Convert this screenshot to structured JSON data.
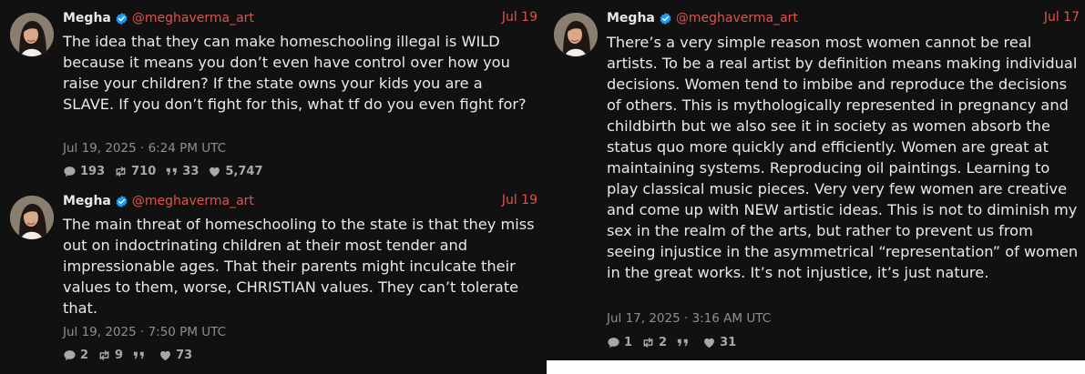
{
  "tweets": [
    {
      "name": "Megha",
      "handle": "@meghaverma_art",
      "date": "Jul 19",
      "text": "The idea that they can make homeschooling illegal is WILD because it means you don’t even have control over how you raise your children? If the state owns your kids you are a SLAVE. If you don’t fight for this, what tf do you even fight for?",
      "timestamp": "Jul 19, 2025 · 6:24 PM UTC",
      "stats": {
        "replies": "193",
        "retweets": "710",
        "quotes": "33",
        "likes": "5,747"
      }
    },
    {
      "name": "Megha",
      "handle": "@meghaverma_art",
      "date": "Jul 19",
      "text": "The main threat of homeschooling to the state is that they miss out on indoctrinating children at their most tender and impressionable ages. That their parents might inculcate their values to them, worse, CHRISTIAN values. They can’t tolerate that.",
      "timestamp": "Jul 19, 2025 · 7:50 PM UTC",
      "stats": {
        "replies": "2",
        "retweets": "9",
        "quotes": "",
        "likes": "73"
      }
    },
    {
      "name": "Megha",
      "handle": "@meghaverma_art",
      "date": "Jul 17",
      "text": "There’s a very simple reason most women cannot be real artists. To be a real artist by definition means making individual decisions. Women tend to imbibe and reproduce the decisions of others. This is mythologically represented in pregnancy and childbirth but we also see it in society as women absorb the status quo more quickly and efficiently. Women are great at maintaining systems. Reproducing oil paintings. Learning to play classical music pieces. Very very few women are creative and come up with NEW artistic ideas. This is not to diminish my sex in the realm of the arts, but rather to prevent us from seeing injustice in the asymmetrical “representation” of women in the great works. It’s not injustice, it’s just nature.",
      "timestamp": "Jul 17, 2025 · 3:16 AM UTC",
      "stats": {
        "replies": "1",
        "retweets": "2",
        "quotes": "",
        "likes": "31"
      }
    }
  ],
  "icons": {
    "reply": "comment-icon",
    "retweet": "retweet-icon",
    "quote": "quote-icon",
    "like": "heart-icon",
    "verified": "verified-badge-icon"
  },
  "colors": {
    "background": "#111111",
    "accent": "#e0524a",
    "text": "#e7e9ea",
    "muted": "#8b8f95",
    "verified": "#1d9bf0"
  }
}
